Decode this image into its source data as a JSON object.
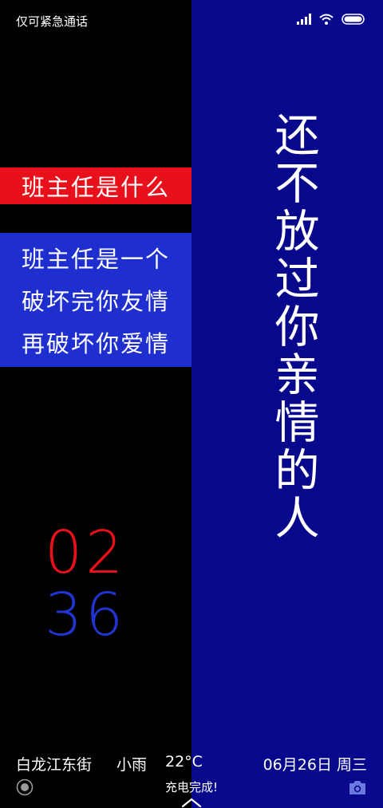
{
  "status_bar": {
    "carrier_text": "仅可紧急通话",
    "icons": [
      "signal-icon",
      "wifi-icon",
      "battery-icon"
    ]
  },
  "poster": {
    "vertical_text": "还不放过你亲情的人",
    "question": "班主任是什么",
    "answer_lines": [
      "班主任是一个",
      "破坏完你友情",
      "再破坏你爱情"
    ]
  },
  "clock": {
    "hours": "02",
    "minutes": "36"
  },
  "weather": {
    "location": "白龙江东街",
    "condition": "小雨",
    "temperature": "22°C"
  },
  "date": "06月26日 周三",
  "charge_status": "充电完成!",
  "colors": {
    "red": "#e8101a",
    "blue": "#2234d0",
    "navy": "#08088c",
    "box_blue": "#1f2fcf"
  }
}
